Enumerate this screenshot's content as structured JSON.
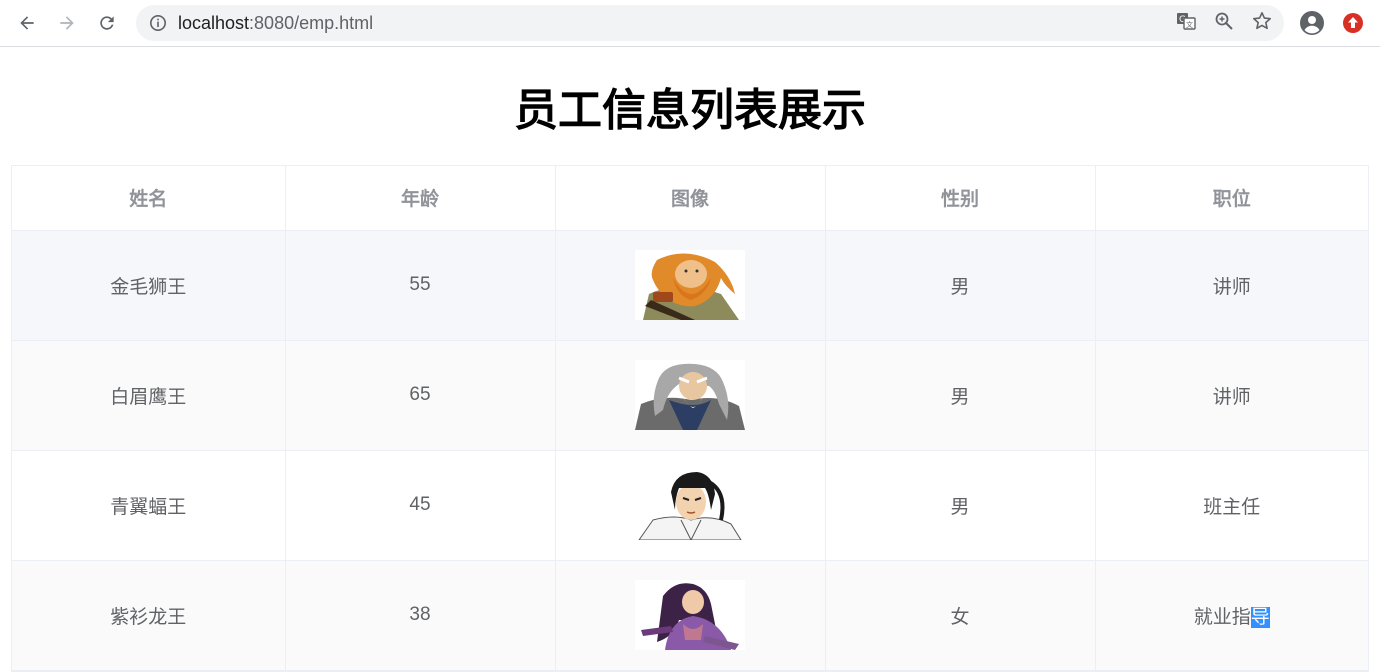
{
  "browser": {
    "url_host": "localhost",
    "url_rest": ":8080/emp.html"
  },
  "page": {
    "title": "员工信息列表展示"
  },
  "table": {
    "headers": [
      "姓名",
      "年龄",
      "图像",
      "性别",
      "职位"
    ],
    "rows": [
      {
        "name": "金毛狮王",
        "age": "55",
        "image": "golden-lion-king-avatar",
        "gender": "男",
        "position": "讲师"
      },
      {
        "name": "白眉鹰王",
        "age": "65",
        "image": "white-eyebrow-eagle-king-avatar",
        "gender": "男",
        "position": "讲师"
      },
      {
        "name": "青翼蝠王",
        "age": "45",
        "image": "green-wing-bat-king-avatar",
        "gender": "男",
        "position": "班主任"
      },
      {
        "name": "紫衫龙王",
        "age": "38",
        "image": "purple-robe-dragon-king-avatar",
        "gender": "女",
        "position_before_selection": "就业指",
        "position_selected": "导"
      }
    ]
  },
  "colors": {
    "header_text": "#909399",
    "cell_text": "#606266",
    "selection": "#3390ff"
  }
}
